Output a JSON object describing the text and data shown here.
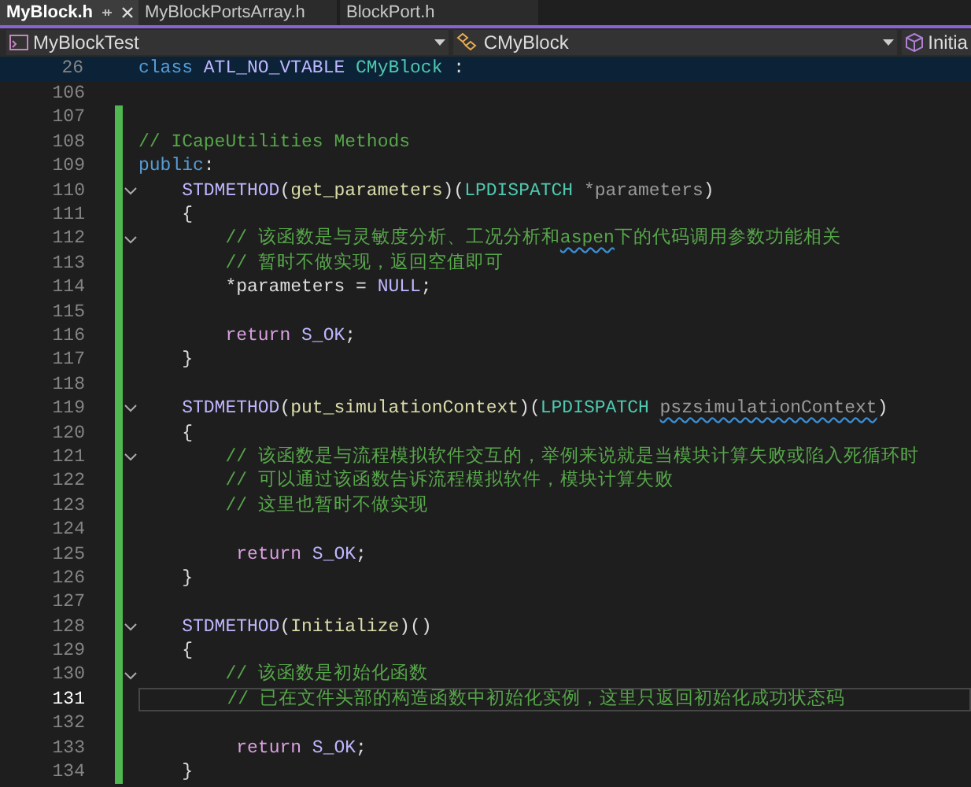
{
  "tabs": [
    {
      "label": "MyBlock.h",
      "selected": true
    },
    {
      "label": "MyBlockPortsArray.h",
      "selected": false
    },
    {
      "label": "BlockPort.h",
      "selected": false
    }
  ],
  "nav": [
    {
      "label": "MyBlockTest",
      "kind": "project"
    },
    {
      "label": "CMyBlock",
      "kind": "class"
    },
    {
      "label": "Initia",
      "kind": "member"
    }
  ],
  "sticky": {
    "number": "26",
    "tokens": [
      {
        "text": "class",
        "kind": "keyword"
      },
      {
        "text": "ATL_NO_VTABLE",
        "kind": "macro",
        "space_before": true
      },
      {
        "text": "CMyBlock",
        "kind": "type",
        "space_before": true
      },
      {
        "text": ":",
        "kind": "plain",
        "space_before": true
      }
    ]
  },
  "lines": [
    {
      "number": "106",
      "fold": false,
      "modified": false,
      "current": false
    },
    {
      "number": "107",
      "fold": false,
      "modified": true,
      "current": false
    },
    {
      "number": "108",
      "fold": false,
      "modified": true,
      "current": false,
      "kind": "flush",
      "tokens": [
        {
          "text": "// ICapeUtilities Methods",
          "kind": "comment"
        }
      ]
    },
    {
      "number": "109",
      "fold": false,
      "modified": true,
      "current": false,
      "kind": "flush",
      "tokens": [
        {
          "text": "public",
          "kind": "keyword"
        },
        {
          "text": ":",
          "kind": "plain"
        }
      ]
    },
    {
      "number": "110",
      "fold": true,
      "modified": true,
      "current": false,
      "kind": "member",
      "tokens": [
        {
          "text": "STDMETHOD",
          "kind": "macro"
        },
        {
          "text": "(",
          "kind": "plain"
        },
        {
          "text": "get_parameters",
          "kind": "function"
        },
        {
          "text": ")(",
          "kind": "plain"
        },
        {
          "text": "LPDISPATCH",
          "kind": "type"
        },
        {
          "text": "*parameters",
          "kind": "param",
          "space_before": true
        },
        {
          "text": ")",
          "kind": "plain"
        }
      ]
    },
    {
      "number": "111",
      "fold": false,
      "modified": true,
      "current": false,
      "kind": "member",
      "tokens": [
        {
          "text": "{",
          "kind": "plain"
        }
      ]
    },
    {
      "number": "112",
      "fold": true,
      "modified": true,
      "current": false,
      "kind": "body",
      "tokens": [
        {
          "text": "// 该函数是与灵敏度分析、工况分析和",
          "kind": "comment"
        },
        {
          "text": "aspen",
          "kind": "comment",
          "squiggle": true
        },
        {
          "text": "下的代码调用参数功能相关",
          "kind": "comment"
        }
      ]
    },
    {
      "number": "113",
      "fold": false,
      "modified": true,
      "current": false,
      "kind": "body",
      "tokens": [
        {
          "text": "// 暂时不做实现，返回空值即可",
          "kind": "comment"
        }
      ]
    },
    {
      "number": "114",
      "fold": false,
      "modified": true,
      "current": false,
      "kind": "body",
      "tokens": [
        {
          "text": "*parameters",
          "kind": "plain"
        },
        {
          "text": "=",
          "kind": "plain",
          "space_before": true
        },
        {
          "text": "NULL",
          "kind": "macro",
          "space_before": true
        },
        {
          "text": ";",
          "kind": "plain"
        }
      ]
    },
    {
      "number": "115",
      "fold": false,
      "modified": true,
      "current": false
    },
    {
      "number": "116",
      "fold": false,
      "modified": true,
      "current": false,
      "kind": "body",
      "tokens": [
        {
          "text": "return",
          "kind": "control"
        },
        {
          "text": "S_OK",
          "kind": "macro",
          "space_before": true
        },
        {
          "text": ";",
          "kind": "plain"
        }
      ]
    },
    {
      "number": "117",
      "fold": false,
      "modified": true,
      "current": false,
      "kind": "member",
      "tokens": [
        {
          "text": "}",
          "kind": "plain"
        }
      ]
    },
    {
      "number": "118",
      "fold": false,
      "modified": true,
      "current": false
    },
    {
      "number": "119",
      "fold": true,
      "modified": true,
      "current": false,
      "kind": "member",
      "tokens": [
        {
          "text": "STDMETHOD",
          "kind": "macro"
        },
        {
          "text": "(",
          "kind": "plain"
        },
        {
          "text": "put_simulationContext",
          "kind": "function"
        },
        {
          "text": ")(",
          "kind": "plain"
        },
        {
          "text": "LPDISPATCH",
          "kind": "type"
        },
        {
          "text": "pszsimulationContext",
          "kind": "param",
          "space_before": true,
          "squiggle": true
        },
        {
          "text": ")",
          "kind": "plain"
        }
      ]
    },
    {
      "number": "120",
      "fold": false,
      "modified": true,
      "current": false,
      "kind": "member",
      "tokens": [
        {
          "text": "{",
          "kind": "plain"
        }
      ]
    },
    {
      "number": "121",
      "fold": true,
      "modified": true,
      "current": false,
      "kind": "body",
      "tokens": [
        {
          "text": "// 该函数是与流程模拟软件交互的，举例来说就是当模块计算失败或陷入死循环时",
          "kind": "comment"
        }
      ]
    },
    {
      "number": "122",
      "fold": false,
      "modified": true,
      "current": false,
      "kind": "body",
      "tokens": [
        {
          "text": "// 可以通过该函数告诉流程模拟软件，模块计算失败",
          "kind": "comment"
        }
      ]
    },
    {
      "number": "123",
      "fold": false,
      "modified": true,
      "current": false,
      "kind": "body",
      "tokens": [
        {
          "text": "// 这里也暂时不做实现",
          "kind": "comment"
        }
      ]
    },
    {
      "number": "124",
      "fold": false,
      "modified": true,
      "current": false
    },
    {
      "number": "125",
      "fold": false,
      "modified": true,
      "current": false,
      "kind": "body_shifted",
      "tokens": [
        {
          "text": "return",
          "kind": "control"
        },
        {
          "text": "S_OK",
          "kind": "macro",
          "space_before": true
        },
        {
          "text": ";",
          "kind": "plain"
        }
      ]
    },
    {
      "number": "126",
      "fold": false,
      "modified": true,
      "current": false,
      "kind": "member",
      "tokens": [
        {
          "text": "}",
          "kind": "plain"
        }
      ]
    },
    {
      "number": "127",
      "fold": false,
      "modified": true,
      "current": false
    },
    {
      "number": "128",
      "fold": true,
      "modified": true,
      "current": false,
      "kind": "member",
      "tokens": [
        {
          "text": "STDMETHOD",
          "kind": "macro"
        },
        {
          "text": "(",
          "kind": "plain"
        },
        {
          "text": "Initialize",
          "kind": "function"
        },
        {
          "text": ")()",
          "kind": "plain"
        }
      ]
    },
    {
      "number": "129",
      "fold": false,
      "modified": true,
      "current": false,
      "kind": "member",
      "tokens": [
        {
          "text": "{",
          "kind": "plain"
        }
      ]
    },
    {
      "number": "130",
      "fold": true,
      "modified": true,
      "current": false,
      "kind": "body",
      "tokens": [
        {
          "text": "// 该函数是初始化函数",
          "kind": "comment"
        }
      ]
    },
    {
      "number": "131",
      "fold": false,
      "modified": true,
      "current": true,
      "kind": "body",
      "tokens": [
        {
          "text": "// 已在文件头部的构造函数中初始化实例，这里只返回初始化成功状态码",
          "kind": "comment"
        }
      ]
    },
    {
      "number": "132",
      "fold": false,
      "modified": true,
      "current": false
    },
    {
      "number": "133",
      "fold": false,
      "modified": true,
      "current": false,
      "kind": "body_shifted",
      "tokens": [
        {
          "text": "return",
          "kind": "control"
        },
        {
          "text": "S_OK",
          "kind": "macro",
          "space_before": true
        },
        {
          "text": ";",
          "kind": "plain"
        }
      ]
    },
    {
      "number": "134",
      "fold": false,
      "modified": true,
      "current": false,
      "kind": "member",
      "tokens": [
        {
          "text": "}",
          "kind": "plain"
        }
      ]
    }
  ]
}
